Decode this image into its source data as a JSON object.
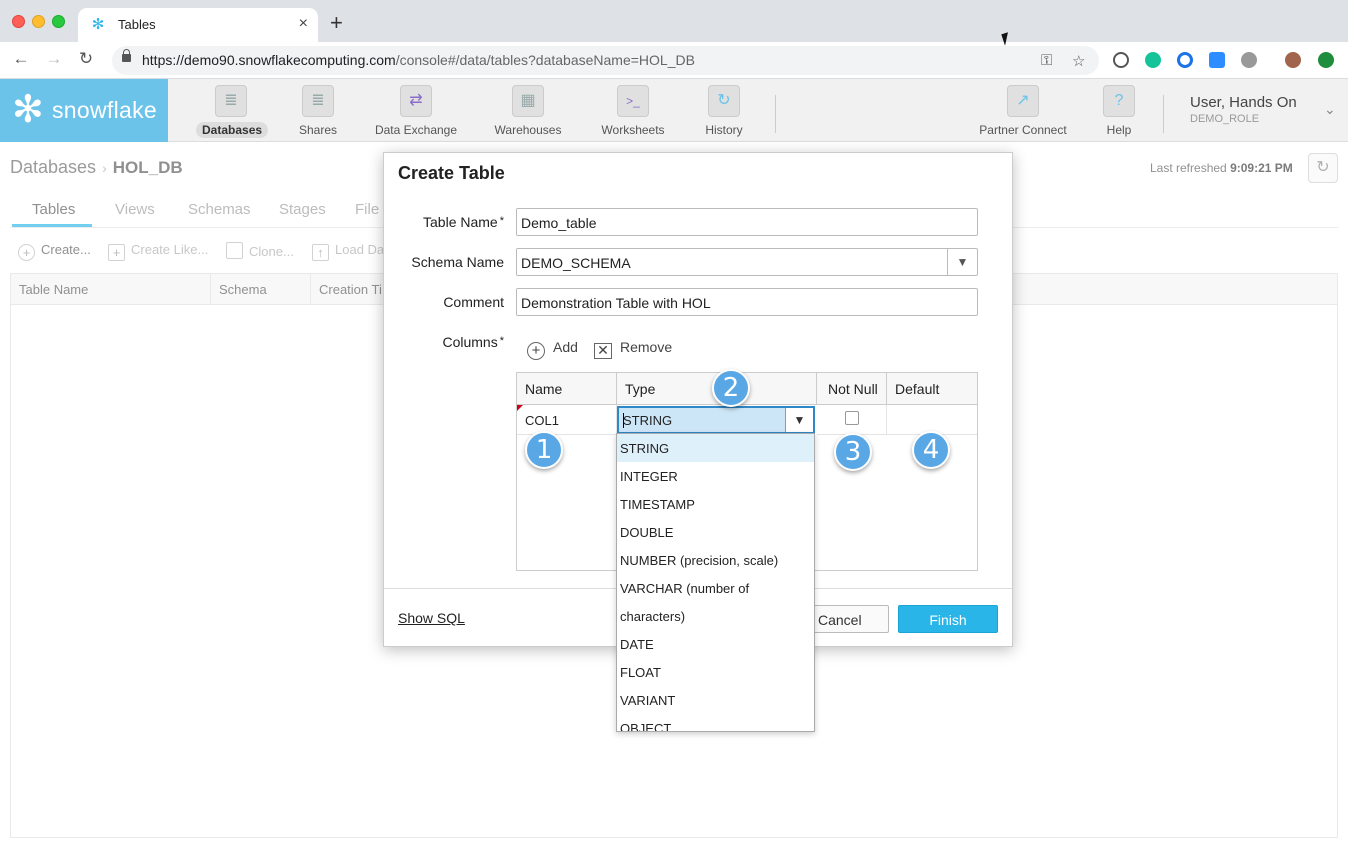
{
  "browser": {
    "tab_title": "Tables",
    "tab_close": "×",
    "new_tab": "+",
    "url_host": "https://demo90.snowflakecomputing.com",
    "url_path": "/console#/data/tables?databaseName=HOL_DB"
  },
  "app": {
    "logo_text": "snowflake",
    "nav": [
      {
        "label": "Databases",
        "icon": "database-icon",
        "glyph": "≣"
      },
      {
        "label": "Shares",
        "icon": "shares-icon",
        "glyph": "≣"
      },
      {
        "label": "Data Exchange",
        "icon": "data-exchange-icon",
        "glyph": "⇄"
      },
      {
        "label": "Warehouses",
        "icon": "warehouses-icon",
        "glyph": "▦"
      },
      {
        "label": "Worksheets",
        "icon": "worksheets-icon",
        "glyph": ">_"
      },
      {
        "label": "History",
        "icon": "history-icon",
        "glyph": "↻"
      },
      {
        "label": "Partner Connect",
        "icon": "partner-connect-icon",
        "glyph": "↗"
      },
      {
        "label": "Help",
        "icon": "help-icon",
        "glyph": "?"
      }
    ],
    "user_name": "User, Hands On",
    "user_role": "DEMO_ROLE"
  },
  "page": {
    "breadcrumb_root": "Databases",
    "breadcrumb_sep": "›",
    "breadcrumb_current": "HOL_DB",
    "last_refreshed_label": "Last refreshed",
    "last_refreshed_time": "9:09:21 PM",
    "tabs": [
      "Tables",
      "Views",
      "Schemas",
      "Stages",
      "File"
    ],
    "actions": [
      "Create...",
      "Create Like...",
      "Clone...",
      "Load Da"
    ],
    "table_headers": [
      "Table Name",
      "Schema",
      "Creation Ti"
    ]
  },
  "dialog": {
    "title": "Create Table",
    "table_name_label": "Table Name",
    "table_name_value": "Demo_table",
    "schema_label": "Schema Name",
    "schema_value": "DEMO_SCHEMA",
    "comment_label": "Comment",
    "comment_value": "Demonstration Table with HOL",
    "columns_label": "Columns",
    "required_mark": "*",
    "add_label": "Add",
    "remove_label": "Remove",
    "col_headers": [
      "Name",
      "Type",
      "Not Null",
      "Default"
    ],
    "row": {
      "name": "COL1",
      "type": "STRING",
      "not_null": false,
      "default": ""
    },
    "show_sql": "Show SQL",
    "cancel": "Cancel",
    "finish": "Finish"
  },
  "type_options": [
    "STRING",
    "INTEGER",
    "TIMESTAMP",
    "DOUBLE",
    "NUMBER (precision, scale)",
    "VARCHAR (number of",
    "characters)",
    "DATE",
    "FLOAT",
    "VARIANT",
    "OBJECT"
  ],
  "badges": [
    "1",
    "2",
    "3",
    "4"
  ],
  "colors": {
    "accent": "#29b5e8",
    "logo_bg": "#6cc3ea",
    "badge": "#5aa7e6"
  }
}
